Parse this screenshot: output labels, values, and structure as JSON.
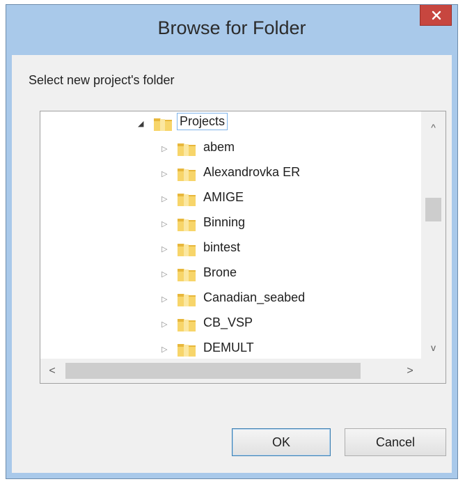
{
  "dialog": {
    "title": "Browse for Folder",
    "prompt": "Select new project's folder",
    "ok_label": "OK",
    "cancel_label": "Cancel",
    "close_icon": "close-icon"
  },
  "tree": {
    "root": {
      "label": "Projects",
      "expanded": true,
      "selected": true
    },
    "items": [
      {
        "label": "abem"
      },
      {
        "label": "Alexandrovka ER"
      },
      {
        "label": "AMIGE"
      },
      {
        "label": "Binning"
      },
      {
        "label": "bintest"
      },
      {
        "label": "Brone"
      },
      {
        "label": "Canadian_seabed"
      },
      {
        "label": "CB_VSP"
      },
      {
        "label": "DEMULT"
      }
    ]
  },
  "colors": {
    "frame": "#a9c9ea",
    "close_button": "#c7463f",
    "selection_border": "#7eb4ea",
    "folder_yellow": "#f2c94c"
  }
}
